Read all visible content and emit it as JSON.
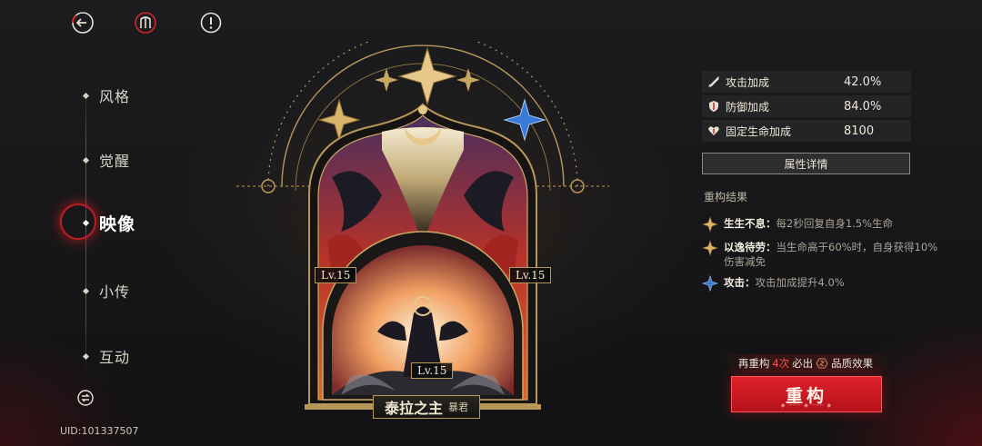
{
  "top_bar": {
    "back_icon": "back-arrow-icon",
    "logo_icon": "emblem-icon",
    "info_icon": "info-icon"
  },
  "nav": {
    "items": [
      {
        "label": "风格",
        "active": false
      },
      {
        "label": "觉醒",
        "active": false
      },
      {
        "label": "映像",
        "active": true
      },
      {
        "label": "小传",
        "active": false
      },
      {
        "label": "互动",
        "active": false
      }
    ],
    "extra_icon": "swap-icon"
  },
  "uid": "UID:101337507",
  "artwork": {
    "level_left": "Lv.15",
    "level_right": "Lv.15",
    "level_bottom": "Lv.15",
    "name": "泰拉之主",
    "subtitle": "暴君"
  },
  "stats": [
    {
      "icon": "sword-icon",
      "label": "攻击加成",
      "value": "42.0%"
    },
    {
      "icon": "shield-icon",
      "label": "防御加成",
      "value": "84.0%"
    },
    {
      "icon": "heart-icon",
      "label": "固定生命加成",
      "value": "8100"
    }
  ],
  "detail_button": "属性详情",
  "reroll_section": {
    "title": "重构结果",
    "effects": [
      {
        "icon": "gold-star-icon",
        "name": "生生不息：",
        "desc": "每2秒回复自身1.5%生命"
      },
      {
        "icon": "gold-star-icon",
        "name": "以逸待劳：",
        "desc": "当生命高于60%时，自身获得10%伤害减免"
      },
      {
        "icon": "blue-star-icon",
        "name": "攻击：",
        "desc": "攻击加成提升4.0%"
      }
    ]
  },
  "guarantee": {
    "prefix": "再重构",
    "count": "4次",
    "middle": "必出",
    "suffix": "品质效果"
  },
  "rebuild_button": "重构",
  "colors": {
    "accent_red": "#d81b27",
    "gold": "#b8975a"
  }
}
